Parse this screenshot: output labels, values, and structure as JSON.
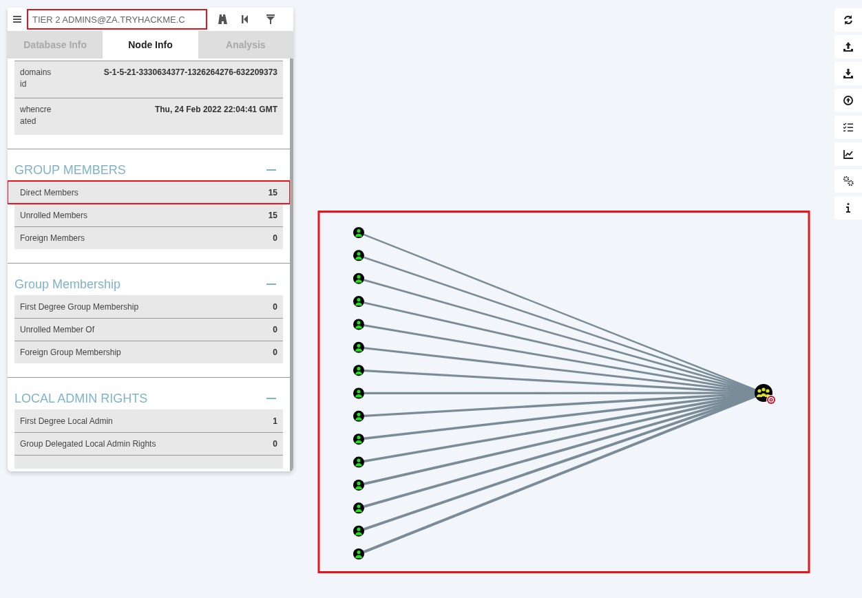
{
  "search": {
    "value": "TIER 2 ADMINS@ZA.TRYHACKME.C",
    "highlighted": true
  },
  "tabs": [
    {
      "label": "Database Info",
      "selected": false
    },
    {
      "label": "Node Info",
      "selected": true
    },
    {
      "label": "Analysis",
      "selected": false
    }
  ],
  "properties": [
    {
      "label": "domains\nid",
      "value": "S-1-5-21-3330634377-1326264276-632209373"
    },
    {
      "label": "whencre\nated",
      "value": "Thu, 24 Feb 2022 22:04:41 GMT"
    }
  ],
  "sections": [
    {
      "title": "GROUP MEMBERS",
      "expanded": true,
      "rows": [
        {
          "label": "Direct Members",
          "value": "15",
          "highlighted": true
        },
        {
          "label": "Unrolled Members",
          "value": "15",
          "highlighted": false
        },
        {
          "label": "Foreign Members",
          "value": "0",
          "highlighted": false
        }
      ]
    },
    {
      "title": "Group Membership",
      "expanded": true,
      "rows": [
        {
          "label": "First Degree Group Membership",
          "value": "0",
          "highlighted": false
        },
        {
          "label": "Unrolled Member Of",
          "value": "0",
          "highlighted": false
        },
        {
          "label": "Foreign Group Membership",
          "value": "0",
          "highlighted": false
        }
      ]
    },
    {
      "title": "LOCAL ADMIN RIGHTS",
      "expanded": true,
      "rows": [
        {
          "label": "First Degree Local Admin",
          "value": "1",
          "highlighted": false
        },
        {
          "label": "Group Delegated Local Admin Rights",
          "value": "0",
          "highlighted": false
        }
      ]
    }
  ],
  "graph": {
    "highlighted": true,
    "nodes": [
      {
        "kind": "user"
      },
      {
        "kind": "user"
      },
      {
        "kind": "user"
      },
      {
        "kind": "user"
      },
      {
        "kind": "user"
      },
      {
        "kind": "user"
      },
      {
        "kind": "user"
      },
      {
        "kind": "user"
      },
      {
        "kind": "user"
      },
      {
        "kind": "user"
      },
      {
        "kind": "user"
      },
      {
        "kind": "user"
      },
      {
        "kind": "user"
      },
      {
        "kind": "user"
      },
      {
        "kind": "user"
      },
      {
        "kind": "group"
      }
    ]
  }
}
